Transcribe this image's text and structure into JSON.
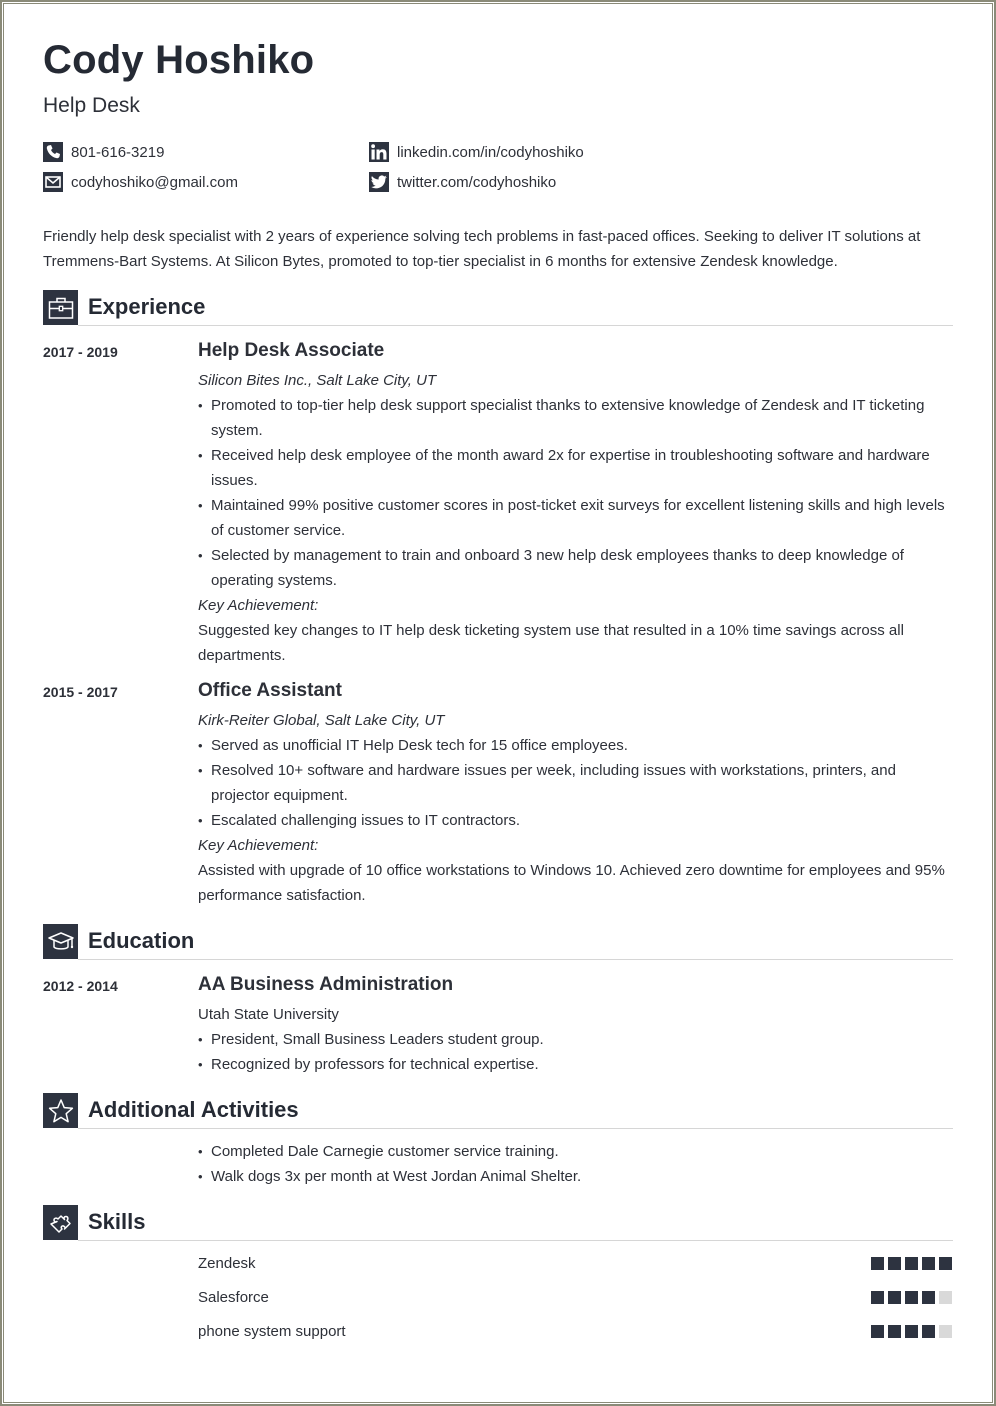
{
  "colors": {
    "accent": "#2d3340",
    "text": "#2d3038",
    "rule": "#d6d6d6",
    "skill_off": "#d9d9d9",
    "frame": "#8a8a78"
  },
  "header": {
    "name": "Cody Hoshiko",
    "title": "Help Desk",
    "contacts": [
      {
        "icon": "phone-icon",
        "text": "801-616-3219"
      },
      {
        "icon": "linkedin-icon",
        "text": "linkedin.com/in/codyhoshiko"
      },
      {
        "icon": "email-icon",
        "text": "codyhoshiko@gmail.com"
      },
      {
        "icon": "twitter-icon",
        "text": "twitter.com/codyhoshiko"
      }
    ]
  },
  "summary": "Friendly help desk specialist with 2 years of experience solving tech problems in fast-paced offices. Seeking to deliver IT solutions at Tremmens-Bart Systems. At Silicon Bytes, promoted to top-tier specialist in 6 months for extensive Zendesk knowledge.",
  "experience": {
    "heading": "Experience",
    "icon": "briefcase-icon",
    "jobs": [
      {
        "dates": "2017 - 2019",
        "role": "Help Desk Associate",
        "company": "Silicon Bites Inc., Salt Lake City, UT",
        "bullets": [
          "Promoted to top-tier help desk support specialist thanks to extensive knowledge of Zendesk and IT ticketing system.",
          "Received help desk employee of the month award 2x for expertise in troubleshooting software and hardware issues.",
          "Maintained 99% positive customer scores in post-ticket exit surveys for excellent listening skills and high levels of customer service.",
          "Selected by management to train and onboard 3 new help desk employees thanks to deep knowledge of operating systems."
        ],
        "key_label": "Key Achievement:",
        "key_text": "Suggested key changes to IT help desk ticketing system use that resulted in a 10% time savings across all departments."
      },
      {
        "dates": "2015 - 2017",
        "role": "Office Assistant",
        "company": "Kirk-Reiter Global, Salt Lake City, UT",
        "bullets": [
          "Served as unofficial IT Help Desk tech for 15 office employees.",
          "Resolved 10+ software and hardware issues per week, including issues with workstations, printers, and projector equipment.",
          "Escalated challenging issues to IT contractors."
        ],
        "key_label": "Key Achievement:",
        "key_text": "Assisted with upgrade of 10 office workstations to Windows 10. Achieved zero downtime for employees and 95% performance satisfaction."
      }
    ]
  },
  "education": {
    "heading": "Education",
    "icon": "graduation-cap-icon",
    "entries": [
      {
        "dates": "2012 - 2014",
        "degree": "AA Business Administration",
        "school": "Utah State University",
        "bullets": [
          "President, Small Business Leaders student group.",
          "Recognized by professors for technical expertise."
        ]
      }
    ]
  },
  "activities": {
    "heading": "Additional Activities",
    "icon": "star-icon",
    "bullets": [
      "Completed Dale Carnegie customer service training.",
      "Walk dogs 3x per month at West Jordan Animal Shelter."
    ]
  },
  "skills": {
    "heading": "Skills",
    "icon": "puzzle-icon",
    "max_level": 5,
    "items": [
      {
        "name": "Zendesk",
        "level": 5
      },
      {
        "name": "Salesforce",
        "level": 4
      },
      {
        "name": "phone system support",
        "level": 4
      }
    ]
  }
}
